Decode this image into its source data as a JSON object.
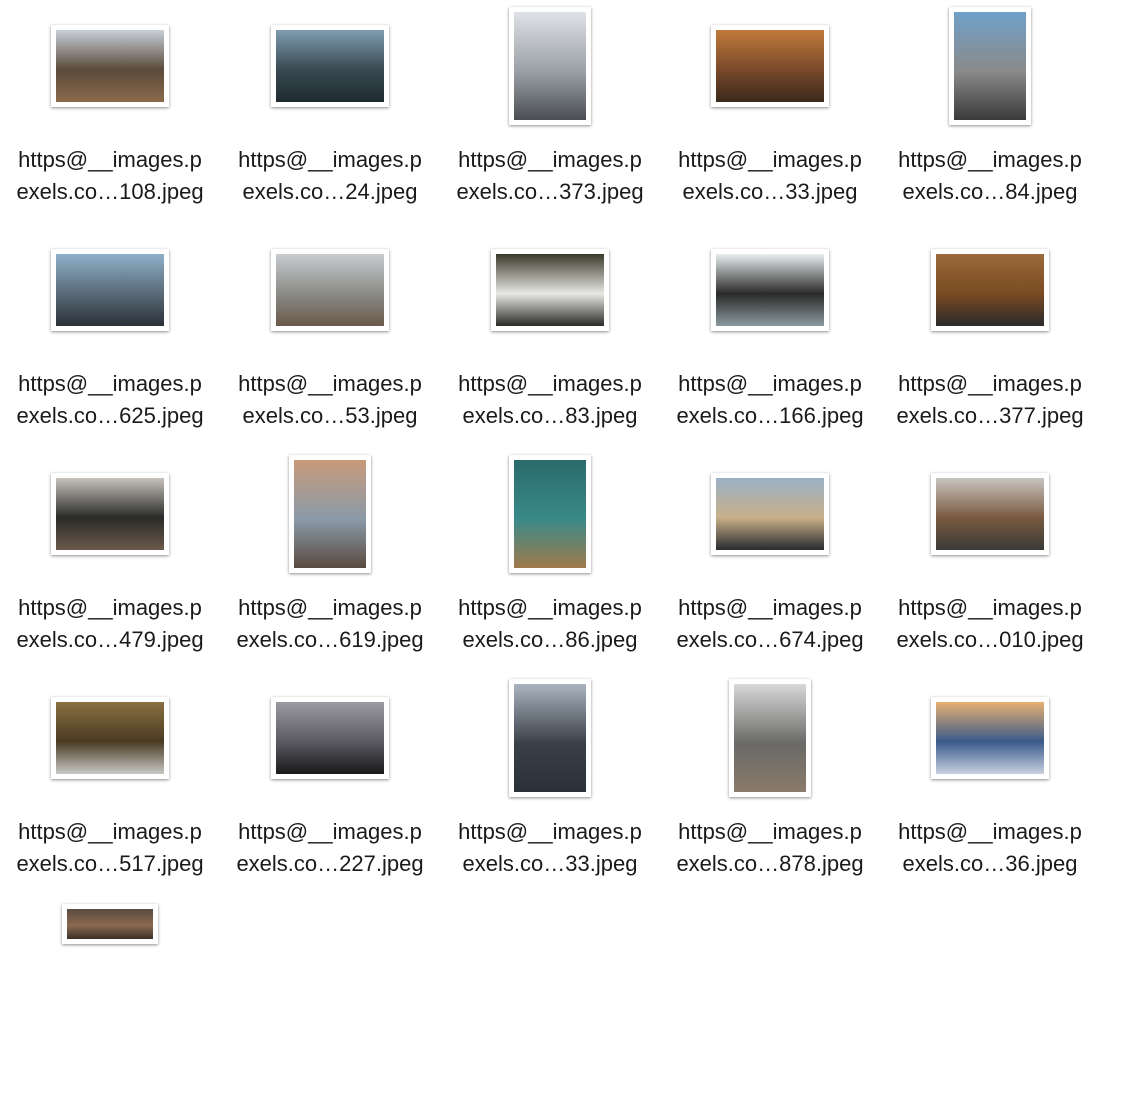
{
  "files": [
    {
      "line1": "https@__images.p",
      "line2": "exels.co…108.jpeg",
      "orientation": "landscape",
      "colors": [
        "#c8d0d8",
        "#5a4a3a",
        "#8a6a4a"
      ]
    },
    {
      "line1": "https@__images.p",
      "line2": "exels.co…24.jpeg",
      "orientation": "landscape",
      "colors": [
        "#7e9bb0",
        "#3a4a52",
        "#1e2a30"
      ]
    },
    {
      "line1": "https@__images.p",
      "line2": "exels.co…373.jpeg",
      "orientation": "portrait",
      "colors": [
        "#dfe2e6",
        "#9aa0a6",
        "#4a4e52"
      ]
    },
    {
      "line1": "https@__images.p",
      "line2": "exels.co…33.jpeg",
      "orientation": "landscape",
      "colors": [
        "#c07a3a",
        "#7a4a2a",
        "#3a2a1a"
      ]
    },
    {
      "line1": "https@__images.p",
      "line2": "exels.co…84.jpeg",
      "orientation": "portrait",
      "colors": [
        "#6fa0c8",
        "#8a8a8a",
        "#3a3a3a"
      ]
    },
    {
      "line1": "https@__images.p",
      "line2": "exels.co…625.jpeg",
      "orientation": "landscape",
      "colors": [
        "#8fb0c8",
        "#5a6a78",
        "#2a3038"
      ]
    },
    {
      "line1": "https@__images.p",
      "line2": "exels.co…53.jpeg",
      "orientation": "landscape",
      "colors": [
        "#c8ccd0",
        "#8a8a86",
        "#6a5a4a"
      ]
    },
    {
      "line1": "https@__images.p",
      "line2": "exels.co…83.jpeg",
      "orientation": "landscape",
      "colors": [
        "#3a3a2a",
        "#e8e8e4",
        "#2a2a26"
      ]
    },
    {
      "line1": "https@__images.p",
      "line2": "exels.co…166.jpeg",
      "orientation": "landscape",
      "colors": [
        "#e8eef0",
        "#2a2a28",
        "#8a9aa0"
      ]
    },
    {
      "line1": "https@__images.p",
      "line2": "exels.co…377.jpeg",
      "orientation": "landscape",
      "colors": [
        "#9a6a3a",
        "#7a4a22",
        "#2a2a2a"
      ]
    },
    {
      "line1": "https@__images.p",
      "line2": "exels.co…479.jpeg",
      "orientation": "landscape",
      "colors": [
        "#c8c4bc",
        "#2a2a28",
        "#6a5a4a"
      ]
    },
    {
      "line1": "https@__images.p",
      "line2": "exels.co…619.jpeg",
      "orientation": "portrait",
      "colors": [
        "#c89a7a",
        "#8a9aa8",
        "#5a4a40"
      ]
    },
    {
      "line1": "https@__images.p",
      "line2": "exels.co…86.jpeg",
      "orientation": "portrait",
      "colors": [
        "#2a6a6a",
        "#3a8a8a",
        "#a07a4a"
      ]
    },
    {
      "line1": "https@__images.p",
      "line2": "exels.co…674.jpeg",
      "orientation": "landscape",
      "colors": [
        "#9ab0c8",
        "#c8b088",
        "#2a2a30"
      ]
    },
    {
      "line1": "https@__images.p",
      "line2": "exels.co…010.jpeg",
      "orientation": "landscape",
      "colors": [
        "#c8c4c0",
        "#7a5a40",
        "#3a3a38"
      ]
    },
    {
      "line1": "https@__images.p",
      "line2": "exels.co…517.jpeg",
      "orientation": "landscape",
      "colors": [
        "#8a7040",
        "#4a3a22",
        "#c8c8c4"
      ]
    },
    {
      "line1": "https@__images.p",
      "line2": "exels.co…227.jpeg",
      "orientation": "landscape",
      "colors": [
        "#9a9aa0",
        "#5a5a60",
        "#1a1a1c"
      ]
    },
    {
      "line1": "https@__images.p",
      "line2": "exels.co…33.jpeg",
      "orientation": "portrait",
      "colors": [
        "#aab4c0",
        "#3a4048",
        "#2a3038"
      ]
    },
    {
      "line1": "https@__images.p",
      "line2": "exels.co…878.jpeg",
      "orientation": "portrait",
      "colors": [
        "#d8d8d8",
        "#6a6a68",
        "#8a7a6a"
      ]
    },
    {
      "line1": "https@__images.p",
      "line2": "exels.co…36.jpeg",
      "orientation": "landscape",
      "colors": [
        "#e8b070",
        "#3a5a8a",
        "#c8d0e0"
      ]
    },
    {
      "line1": "",
      "line2": "",
      "orientation": "partial",
      "colors": [
        "#5a4a40",
        "#8a6a50",
        "#3a3028"
      ]
    }
  ]
}
